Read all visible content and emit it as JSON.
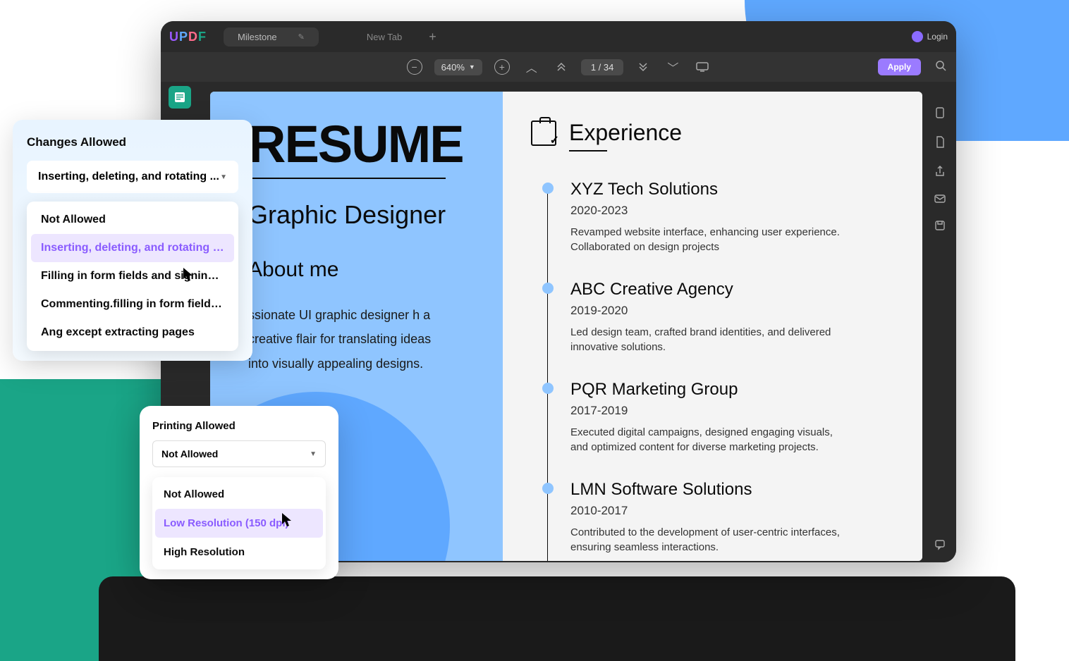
{
  "header": {
    "logo": {
      "u": "U",
      "p": "P",
      "d": "D",
      "f": "F"
    },
    "tab_active": "Milestone",
    "tab_new": "New Tab",
    "login_label": "Login"
  },
  "toolbar": {
    "zoom": "640%",
    "page_indicator": "1  /  34",
    "apply_label": "Apply"
  },
  "document": {
    "resume_title": "RESUME",
    "job_title": "Graphic Designer",
    "about_heading": "About me",
    "about_text": "ssionate UI graphic designer h a creative flair for translating ideas into visually appealing designs.",
    "experience_heading": "Experience",
    "experience": [
      {
        "company": "XYZ Tech Solutions",
        "years": "2020-2023",
        "desc": "Revamped website interface, enhancing user experience. Collaborated on design projects"
      },
      {
        "company": "ABC Creative Agency",
        "years": "2019-2020",
        "desc": "Led design team, crafted brand identities, and delivered innovative solutions."
      },
      {
        "company": "PQR Marketing Group",
        "years": "2017-2019",
        "desc": "Executed digital campaigns, designed engaging visuals, and optimized content for diverse marketing projects."
      },
      {
        "company": "LMN Software Solutions",
        "years": "2010-2017",
        "desc": "Contributed to the development of user-centric interfaces, ensuring seamless interactions."
      }
    ]
  },
  "changes_popup": {
    "title": "Changes Allowed",
    "selected": "Inserting, deleting, and rotating ...",
    "options": [
      "Not Allowed",
      "Inserting, deleting, and rotating pages",
      "Filling in form fields and signing existi...",
      "Commenting.filling in form fields, and...",
      "Ang except extracting pages"
    ]
  },
  "printing_popup": {
    "title": "Printing Allowed",
    "selected": "Not Allowed",
    "options": [
      "Not Allowed",
      "Low Resolution (150 dpi)",
      "High Resolution"
    ]
  }
}
